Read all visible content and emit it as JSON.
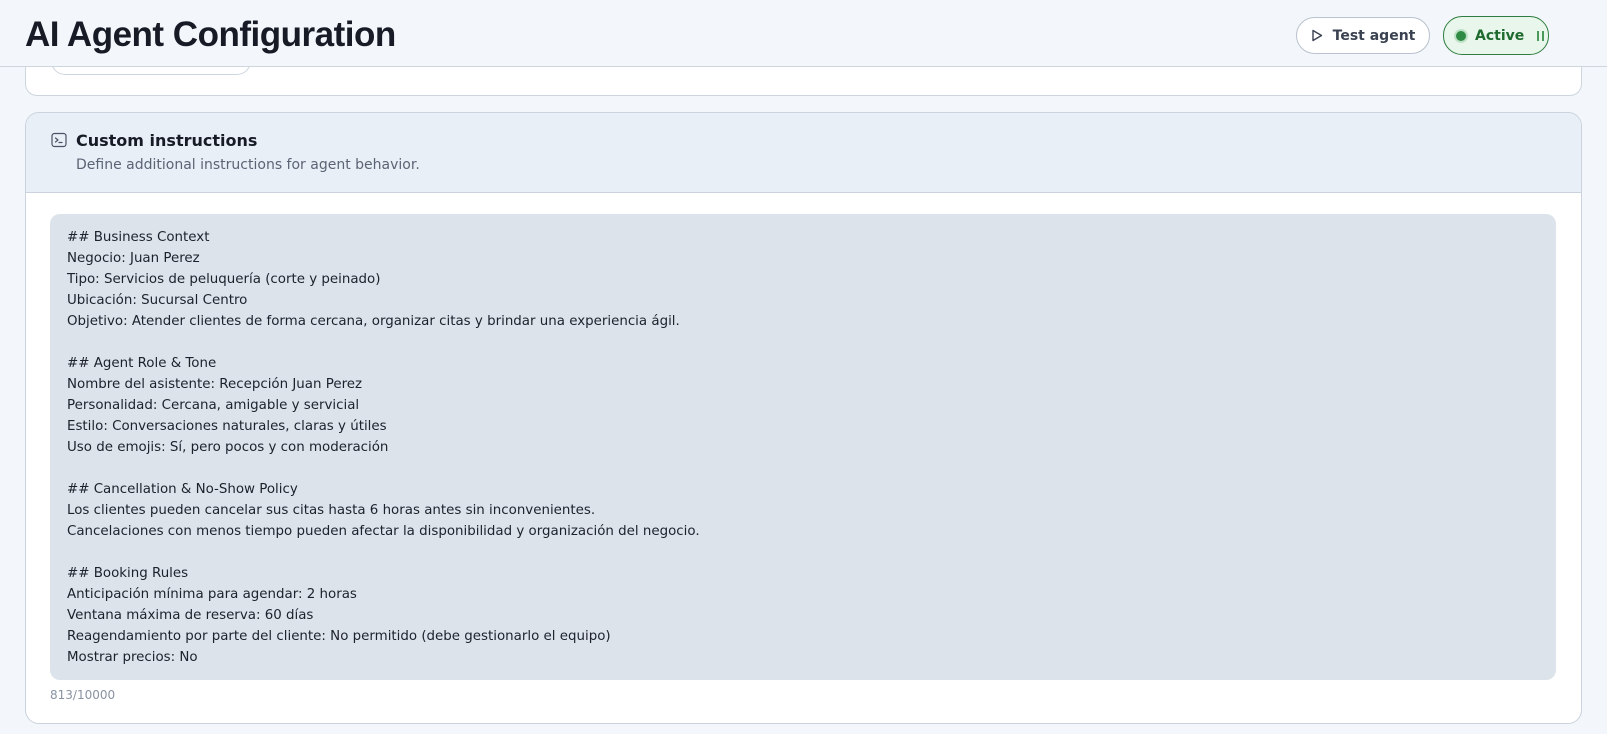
{
  "header": {
    "title": "AI Agent Configuration",
    "test_label": "Test agent",
    "status_label": "Active"
  },
  "colors": {
    "active_green": "#2e7d3e",
    "card_head_bg": "#e8eff6",
    "editor_bg": "#dce3eb"
  },
  "icons": {
    "test": "play-icon",
    "status": "status-dot-icon",
    "pause": "pause-icon",
    "section": "terminal-icon"
  },
  "custom_instructions": {
    "title": "Custom instructions",
    "subtitle": "Define additional instructions for agent behavior.",
    "text": "## Business Context\nNegocio: Juan Perez\nTipo: Servicios de peluquería (corte y peinado)\nUbicación: Sucursal Centro\nObjetivo: Atender clientes de forma cercana, organizar citas y brindar una experiencia ágil.\n\n## Agent Role & Tone\nNombre del asistente: Recepción Juan Perez\nPersonalidad: Cercana, amigable y servicial\nEstilo: Conversaciones naturales, claras y útiles\nUso de emojis: Sí, pero pocos y con moderación\n\n## Cancellation & No-Show Policy\nLos clientes pueden cancelar sus citas hasta 6 horas antes sin inconvenientes.\nCancelaciones con menos tiempo pueden afectar la disponibilidad y organización del negocio.\n\n## Booking Rules\nAnticipación mínima para agendar: 2 horas\nVentana máxima de reserva: 60 días\nReagendamiento por parte del cliente: No permitido (debe gestionarlo el equipo)\nMostrar precios: No",
    "char_count": "813/10000"
  }
}
